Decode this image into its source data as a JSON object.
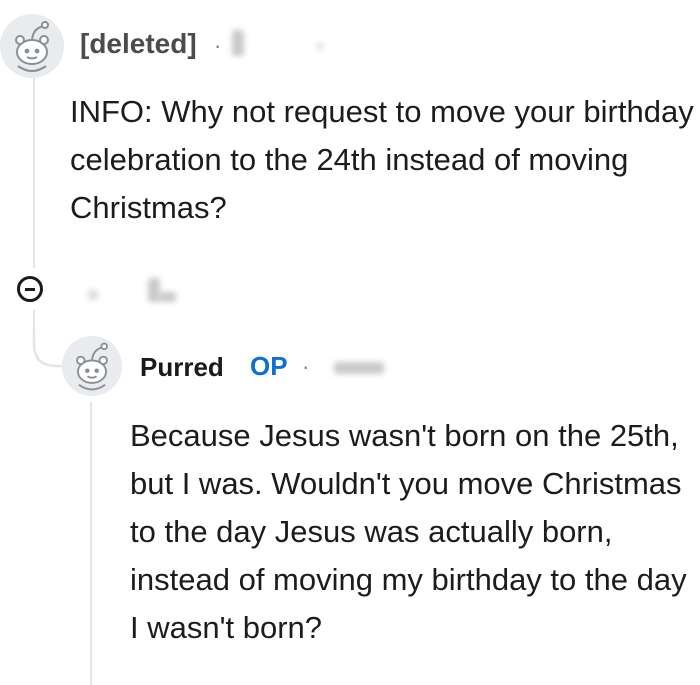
{
  "comment": {
    "author": "[deleted]",
    "separator": "·",
    "body": "INFO: Why not request to move your birthday celebration to the 24th instead of moving Christmas?"
  },
  "reply": {
    "author": "Purred",
    "badge": "OP",
    "separator": "·",
    "body": "Because Jesus wasn't born on the 25th, but I was. Wouldn't you move Christmas to the day Jesus was actually born, instead of moving my birthday to the day I wasn't born?"
  },
  "icons": {
    "avatar": "reddit-snoo-avatar-icon",
    "collapse": "collapse-minus-icon"
  },
  "colors": {
    "op_badge": "#0a6fd6",
    "thread_line": "#e3e5e8",
    "text": "#1c1c1c"
  }
}
